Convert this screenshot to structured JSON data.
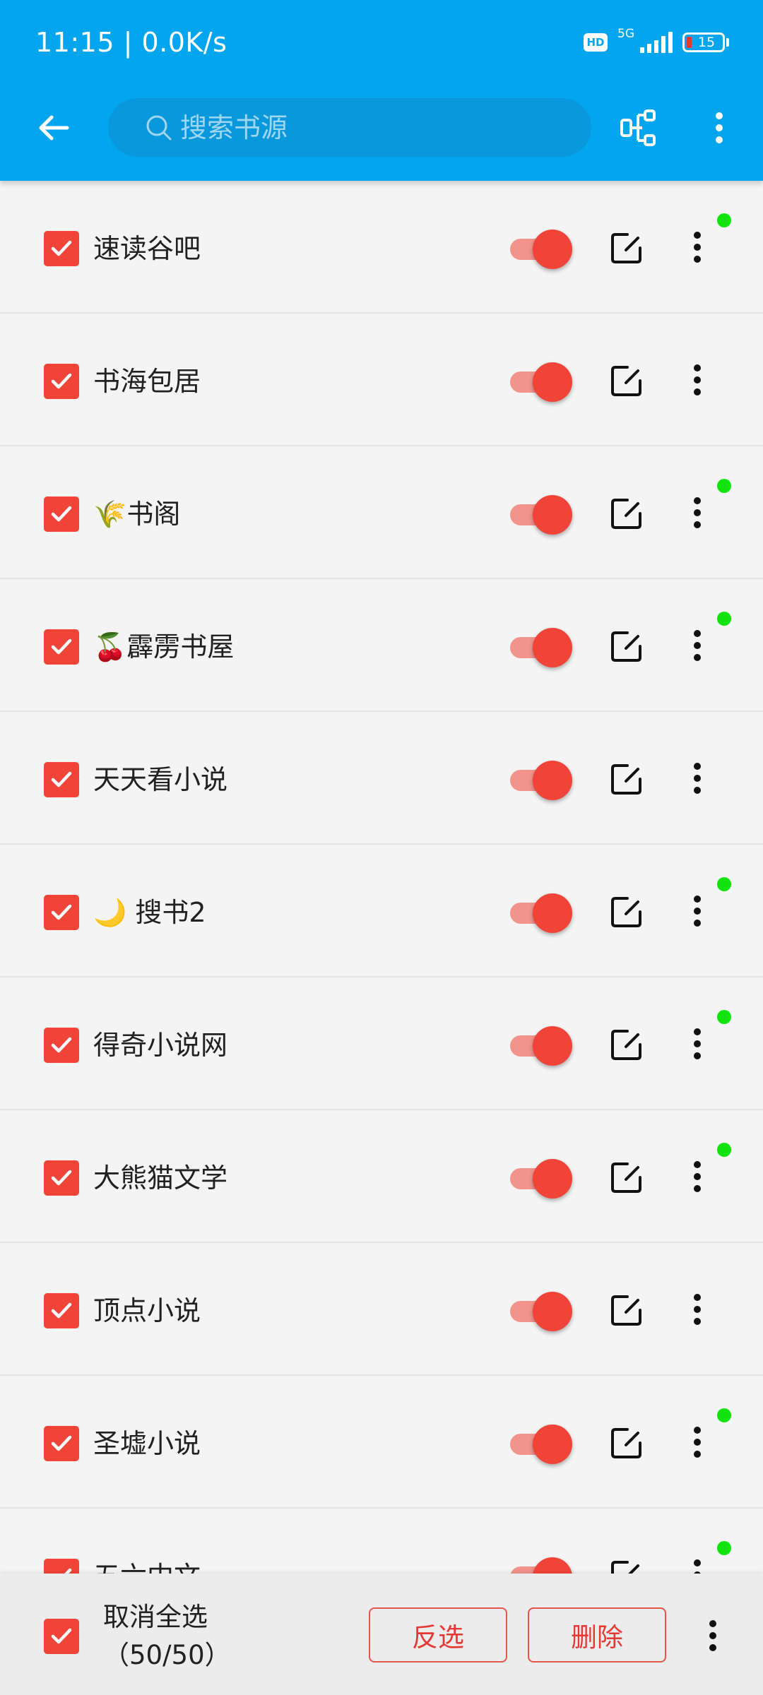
{
  "status_bar": {
    "time_speed": "11:15 | 0.0K/s",
    "hd": "HD",
    "network": "5G",
    "battery": "15"
  },
  "toolbar": {
    "back_icon": "arrow-left-icon",
    "search_placeholder": "搜索书源",
    "group_icon": "group-tree-icon",
    "menu_icon": "more-vertical-icon"
  },
  "sources": [
    {
      "name": "速读谷吧",
      "checked": true,
      "enabled": true,
      "has_dot": true
    },
    {
      "name": "书海包居",
      "checked": true,
      "enabled": true,
      "has_dot": false
    },
    {
      "name": "🌾书阁",
      "checked": true,
      "enabled": true,
      "has_dot": true
    },
    {
      "name": "🍒霹雳书屋",
      "checked": true,
      "enabled": true,
      "has_dot": true
    },
    {
      "name": "天天看小说",
      "checked": true,
      "enabled": true,
      "has_dot": false
    },
    {
      "name": "🌙 搜书2",
      "checked": true,
      "enabled": true,
      "has_dot": true
    },
    {
      "name": "得奇小说网",
      "checked": true,
      "enabled": true,
      "has_dot": true
    },
    {
      "name": "大熊猫文学",
      "checked": true,
      "enabled": true,
      "has_dot": true
    },
    {
      "name": "顶点小说",
      "checked": true,
      "enabled": true,
      "has_dot": false
    },
    {
      "name": "圣墟小说",
      "checked": true,
      "enabled": true,
      "has_dot": true
    },
    {
      "name": "五六中文",
      "checked": true,
      "enabled": true,
      "has_dot": true
    }
  ],
  "bottom_bar": {
    "select_label": "取消全选",
    "select_count": "（50/50）",
    "invert_label": "反选",
    "delete_label": "删除"
  },
  "colors": {
    "primary": "#03a5ef",
    "accent": "#f04438",
    "online_dot": "#11e30f"
  }
}
